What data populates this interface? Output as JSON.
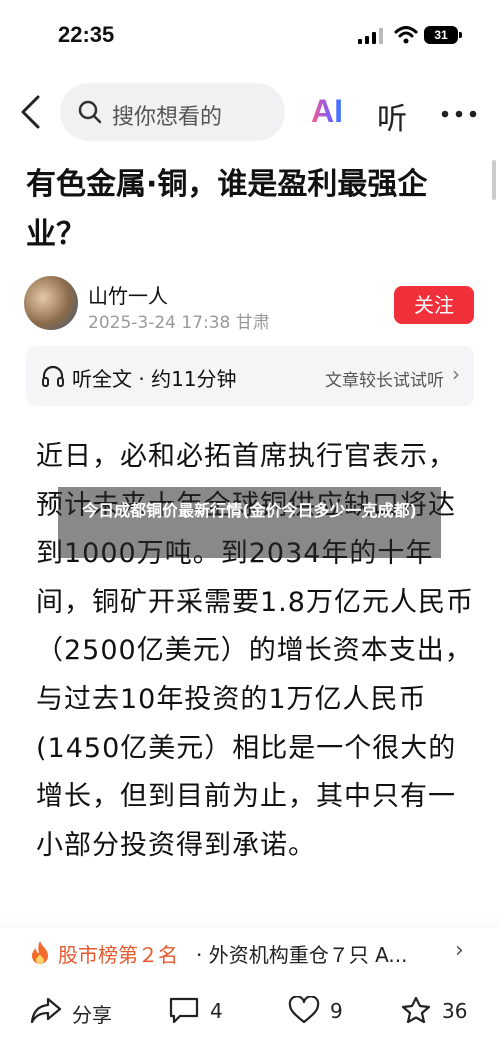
{
  "status_bar": {
    "time": "22:35",
    "battery": "31"
  },
  "nav": {
    "search_placeholder": "搜你想看的",
    "ai_label": "AI",
    "listen_label": "听"
  },
  "article": {
    "title": "有色金属·铜，谁是盈利最强企业？",
    "author": {
      "name": "山竹一人",
      "meta": "2025-3-24 17:38 甘肃",
      "follow_label": "关注"
    },
    "listen_bar": {
      "label": "听全文 · 约11分钟",
      "right_label": "文章较长试试听"
    },
    "body": "近日，必和必拓首席执行官表示，预计未来十年全球铜供应缺口将达到1000万吨。到2034年的十年间，铜矿开采需要1.8万亿元人民币（2500亿美元）的增长资本支出，与过去10年投资的1万亿人民币(1450亿美元）相比是一个很大的增长，但到目前为止，其中只有一小部分投资得到承诺。",
    "overlay": "今日成都铜价最新行情(金价今日多少一克成都)"
  },
  "hot_bar": {
    "rank": "股市榜第２名",
    "text": "· 外资机构重仓７只 A..."
  },
  "actions": {
    "share": "分享",
    "comments": "4",
    "likes": "9",
    "favorites": "36"
  }
}
